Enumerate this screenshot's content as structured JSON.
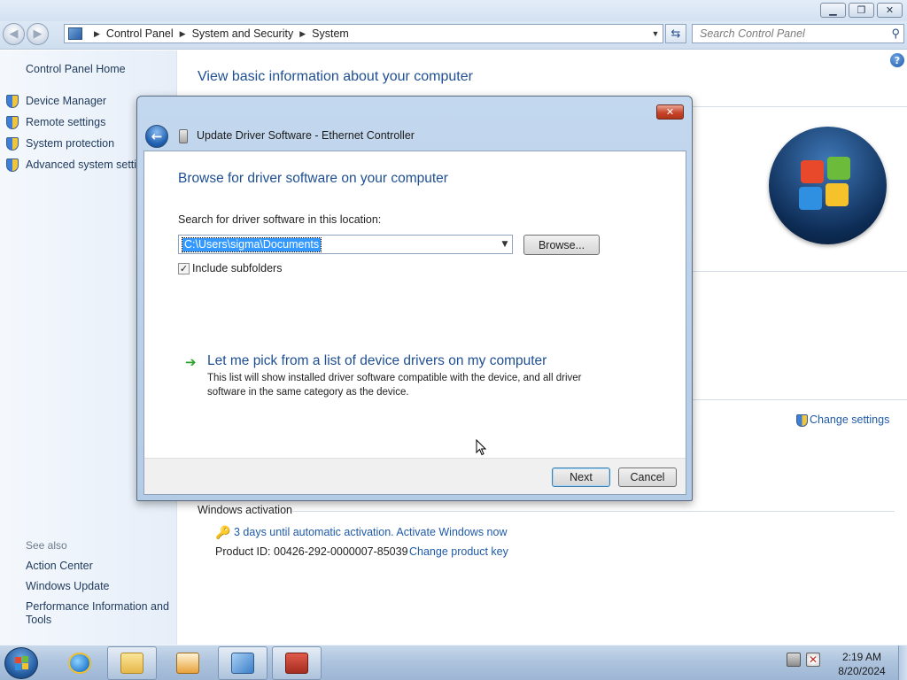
{
  "explorer": {
    "address": {
      "crumbs": [
        "Control Panel",
        "System and Security",
        "System"
      ]
    },
    "search_placeholder": "Search Control Panel",
    "left_pane": {
      "home": "Control Panel Home",
      "links": [
        "Device Manager",
        "Remote settings",
        "System protection",
        "Advanced system settings"
      ],
      "see_also_heading": "See also",
      "see_also": [
        "Action Center",
        "Windows Update",
        "Performance Information and Tools"
      ]
    },
    "main": {
      "heading": "View basic information about your computer",
      "change_settings": "Change settings",
      "activation_heading": "Windows activation",
      "activation_link": "3 days until automatic activation. Activate Windows now",
      "product_id": "Product ID: 00426-292-0000007-85039",
      "change_product_key": "Change product key"
    }
  },
  "dialog": {
    "title": "Update Driver Software - Ethernet Controller",
    "heading": "Browse for driver software on your computer",
    "search_label": "Search for driver software in this location:",
    "path_value": "C:\\Users\\sigma\\Documents",
    "browse_label": "Browse...",
    "include_subfolders_label": "Include subfolders",
    "include_subfolders_checked": true,
    "pick_link": "Let me pick from a list of device drivers on my computer",
    "pick_description": "This list will show installed driver software compatible with the device, and all driver software in the same category as the device.",
    "next_label": "Next",
    "cancel_label": "Cancel"
  },
  "taskbar": {
    "time": "2:19 AM",
    "date": "8/20/2024",
    "buttons": [
      "internet-explorer",
      "windows-explorer",
      "media-player",
      "control-panel",
      "device-manager"
    ]
  },
  "colors": {
    "link": "#1e5aa8",
    "heading": "#1e4f92",
    "selection": "#3399ff"
  }
}
